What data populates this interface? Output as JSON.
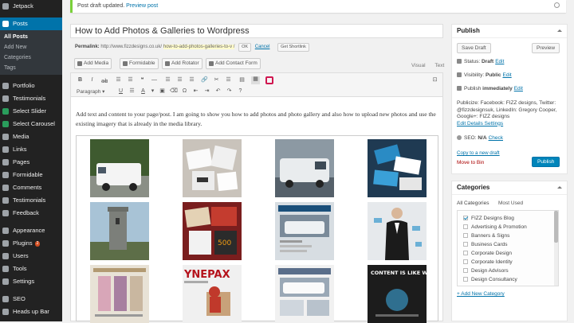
{
  "sidebar": {
    "items": [
      {
        "label": "Jetpack",
        "icon": "jetpack-icon"
      },
      {
        "label": "Posts",
        "icon": "pushpin-icon",
        "current": true
      },
      {
        "label": "Portfolio",
        "icon": "portfolio-icon"
      },
      {
        "label": "Testimonials",
        "icon": "testimonials-icon"
      },
      {
        "label": "Select Slider",
        "icon": "slider-icon"
      },
      {
        "label": "Select Carousel",
        "icon": "carousel-icon"
      },
      {
        "label": "Media",
        "icon": "media-icon"
      },
      {
        "label": "Links",
        "icon": "links-icon"
      },
      {
        "label": "Pages",
        "icon": "pages-icon"
      },
      {
        "label": "Formidable",
        "icon": "formidable-icon"
      },
      {
        "label": "Comments",
        "icon": "comments-icon"
      },
      {
        "label": "Testimonials",
        "icon": "testimonials-icon"
      },
      {
        "label": "Feedback",
        "icon": "feedback-icon"
      },
      {
        "label": "Appearance",
        "icon": "appearance-icon"
      },
      {
        "label": "Plugins",
        "icon": "plugins-icon",
        "badge": "2"
      },
      {
        "label": "Users",
        "icon": "users-icon"
      },
      {
        "label": "Tools",
        "icon": "tools-icon"
      },
      {
        "label": "Settings",
        "icon": "settings-icon"
      },
      {
        "label": "SEO",
        "icon": "seo-icon"
      },
      {
        "label": "Heads up Bar",
        "icon": "headsup-icon"
      }
    ],
    "posts_sub": [
      "All Posts",
      "Add New",
      "Categories",
      "Tags"
    ]
  },
  "notice": {
    "text": "Post draft updated.",
    "link": "Preview post"
  },
  "post": {
    "title": "How to Add Photos & Galleries to Wordpress",
    "permalink_label": "Permalink:",
    "permalink_url": "http://www.fizzdesigns.co.uk/",
    "permalink_slug": "how-to-add-photos-galleries-to-v /",
    "ok": "OK",
    "cancel": "Cancel",
    "shortlink": "Get Shortlink",
    "body": "Add text and content to your page/post. I am going to show you how to add photos and photo gallery and also how to upload new photos and use the existing imagery that is already in the media library."
  },
  "media_buttons": [
    "Add Media",
    "Formidable",
    "Add Rotator",
    "Add Contact Form"
  ],
  "editor_tabs": [
    "Visual",
    "Text"
  ],
  "toolbar": {
    "row1": [
      "B",
      "I",
      "☰",
      "☰",
      "❝",
      "—",
      "☰",
      "☰",
      "☰",
      "🔗",
      "✂",
      "☰",
      "▤",
      "▦",
      "⊡"
    ],
    "format": "Paragraph"
  },
  "publish": {
    "heading": "Publish",
    "save_draft": "Save Draft",
    "preview": "Preview",
    "status_label": "Status:",
    "status_value": "Draft",
    "status_edit": "Edit",
    "visibility_label": "Visibility:",
    "visibility_value": "Public",
    "visibility_edit": "Edit",
    "publish_label": "Publish",
    "publish_value": "immediately",
    "publish_edit": "Edit",
    "publicize_text": "Publicize: Facebook: FIZZ designs, Twitter: @fizzdesignsuk, LinkedIn: Gregory Cooper, Google+: FIZZ designs",
    "publicize_edit": "Edit Details Settings",
    "seo_label": "SEO:",
    "seo_value": "N/A",
    "seo_check": "Check",
    "copy_draft": "Copy to a new draft",
    "move_bin": "Move to Bin",
    "publish_button": "Publish"
  },
  "categories": {
    "heading": "Categories",
    "tab_all": "All Categories",
    "tab_used": "Most Used",
    "items": [
      {
        "label": "FIZZ Designs Blog",
        "checked": true
      },
      {
        "label": "Advertising & Promotion",
        "checked": false
      },
      {
        "label": "Banners & Signs",
        "checked": false
      },
      {
        "label": "Business Cards",
        "checked": false
      },
      {
        "label": "Corporate Design",
        "checked": false
      },
      {
        "label": "Corporate Identity",
        "checked": false
      },
      {
        "label": "Design Advisors",
        "checked": false
      },
      {
        "label": "Design Consultancy",
        "checked": false
      }
    ],
    "add_new": "+ Add New Category"
  },
  "gallery": {
    "thumbs": [
      {
        "name": "van-photo",
        "bg": "#3e5a2f"
      },
      {
        "name": "boxes-photo",
        "bg": "#c9c3bb"
      },
      {
        "name": "van-photo",
        "bg": "#8c99a3"
      },
      {
        "name": "business-cards-photo",
        "bg": "#1f3a52"
      },
      {
        "name": "tower-photo",
        "bg": "#6d7e86"
      },
      {
        "name": "printing-photo",
        "bg": "#7a1e1e"
      },
      {
        "name": "website-photo",
        "bg": "#d7dde2"
      },
      {
        "name": "man-suit-photo",
        "bg": "#e6e9ec"
      },
      {
        "name": "website-photo",
        "bg": "#e8e2d6"
      },
      {
        "name": "logo-photo",
        "bg": "#f0f0f0"
      },
      {
        "name": "website-photo",
        "bg": "#5a6e8a"
      },
      {
        "name": "poster-photo",
        "bg": "#1c1c1c"
      }
    ],
    "texts": [
      "YNEPAX",
      "CONTENT IS LIKE WATER"
    ]
  },
  "colors": {
    "accent": "#0073aa",
    "sidebar": "#222222",
    "publish": "#0085ba",
    "danger": "#a00000"
  }
}
